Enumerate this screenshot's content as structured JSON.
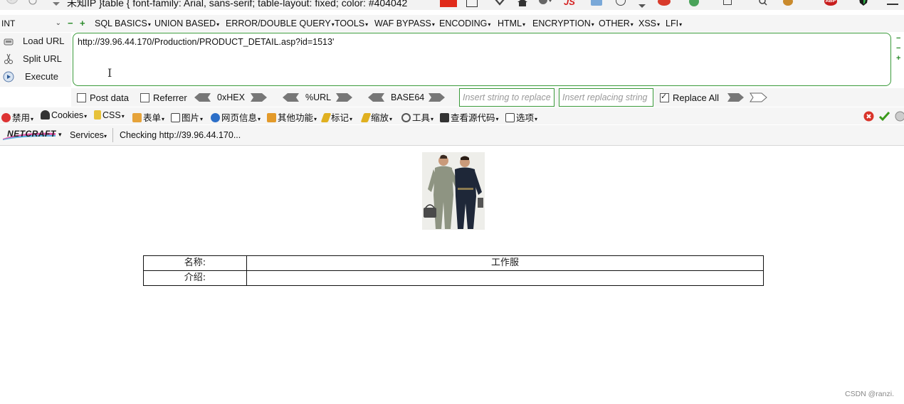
{
  "top_bar": {
    "cut_text": "未知IP   }table { font-family: Arial, sans-serif; table-layout: fixed; color: #404042",
    "js_badge": "JS",
    "abp_badge": "ABP"
  },
  "hackbar": {
    "type_select": "INT",
    "menus": [
      {
        "label": "SQL BASICS"
      },
      {
        "label": "UNION BASED"
      },
      {
        "label": "ERROR/DOUBLE QUERY"
      },
      {
        "label": "TOOLS"
      },
      {
        "label": "WAF BYPASS"
      },
      {
        "label": "ENCODING"
      },
      {
        "label": "HTML"
      },
      {
        "label": "ENCRYPTION"
      },
      {
        "label": "OTHER"
      },
      {
        "label": "XSS"
      },
      {
        "label": "LFI"
      }
    ],
    "actions": {
      "load": "Load URL",
      "split": "Split URL",
      "execute": "Execute"
    },
    "url_value": "http://39.96.44.170/Production/PRODUCT_DETAIL.asp?id=1513'",
    "options": {
      "post_data": "Post data",
      "referrer": "Referrer",
      "hex": "0xHEX",
      "url": "%URL",
      "base64": "BASE64",
      "replace_placeholder": "Insert string to replace",
      "replacing_placeholder": "Insert replacing string",
      "replace_all": "Replace All",
      "replace_all_checked": true
    }
  },
  "webdev_bar": {
    "items": [
      {
        "label": "禁用"
      },
      {
        "label": "Cookies"
      },
      {
        "label": "CSS"
      },
      {
        "label": "表单"
      },
      {
        "label": "图片"
      },
      {
        "label": "网页信息"
      },
      {
        "label": "其他功能"
      },
      {
        "label": "标记"
      },
      {
        "label": "缩放"
      },
      {
        "label": "工具"
      },
      {
        "label": "查看源代码"
      },
      {
        "label": "选项"
      }
    ]
  },
  "netcraft_bar": {
    "logo": "NETCRAFT",
    "services": "Services",
    "status": "Checking http://39.96.44.170..."
  },
  "page": {
    "table": {
      "rows": [
        {
          "label": "名称:",
          "value": "工作服"
        },
        {
          "label": "介绍:",
          "value": ""
        }
      ]
    },
    "watermark": "CSDN @ranzi."
  }
}
